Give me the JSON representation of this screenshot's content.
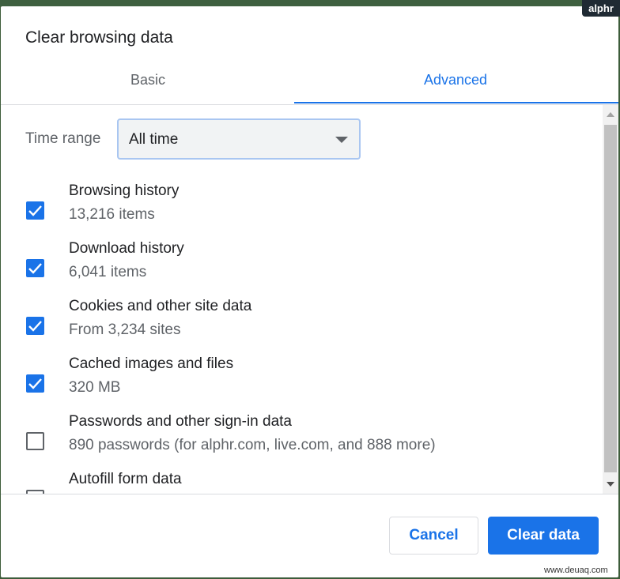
{
  "watermark": "alphr",
  "dialog": {
    "title": "Clear browsing data",
    "tabs": [
      {
        "label": "Basic",
        "active": false
      },
      {
        "label": "Advanced",
        "active": true
      }
    ]
  },
  "time_range": {
    "label": "Time range",
    "selected": "All time"
  },
  "items": [
    {
      "label": "Browsing history",
      "sub": "13,216 items",
      "checked": true
    },
    {
      "label": "Download history",
      "sub": "6,041 items",
      "checked": true
    },
    {
      "label": "Cookies and other site data",
      "sub": "From 3,234 sites",
      "checked": true
    },
    {
      "label": "Cached images and files",
      "sub": "320 MB",
      "checked": true
    },
    {
      "label": "Passwords and other sign-in data",
      "sub": "890 passwords (for alphr.com, live.com, and 888 more)",
      "checked": false
    },
    {
      "label": "Autofill form data",
      "sub": "",
      "checked": false
    }
  ],
  "buttons": {
    "cancel": "Cancel",
    "clear": "Clear data"
  },
  "footer_mark": "www.deuaq.com",
  "colors": {
    "accent": "#1a73e8",
    "text": "#202124",
    "secondary_text": "#5f6368"
  }
}
